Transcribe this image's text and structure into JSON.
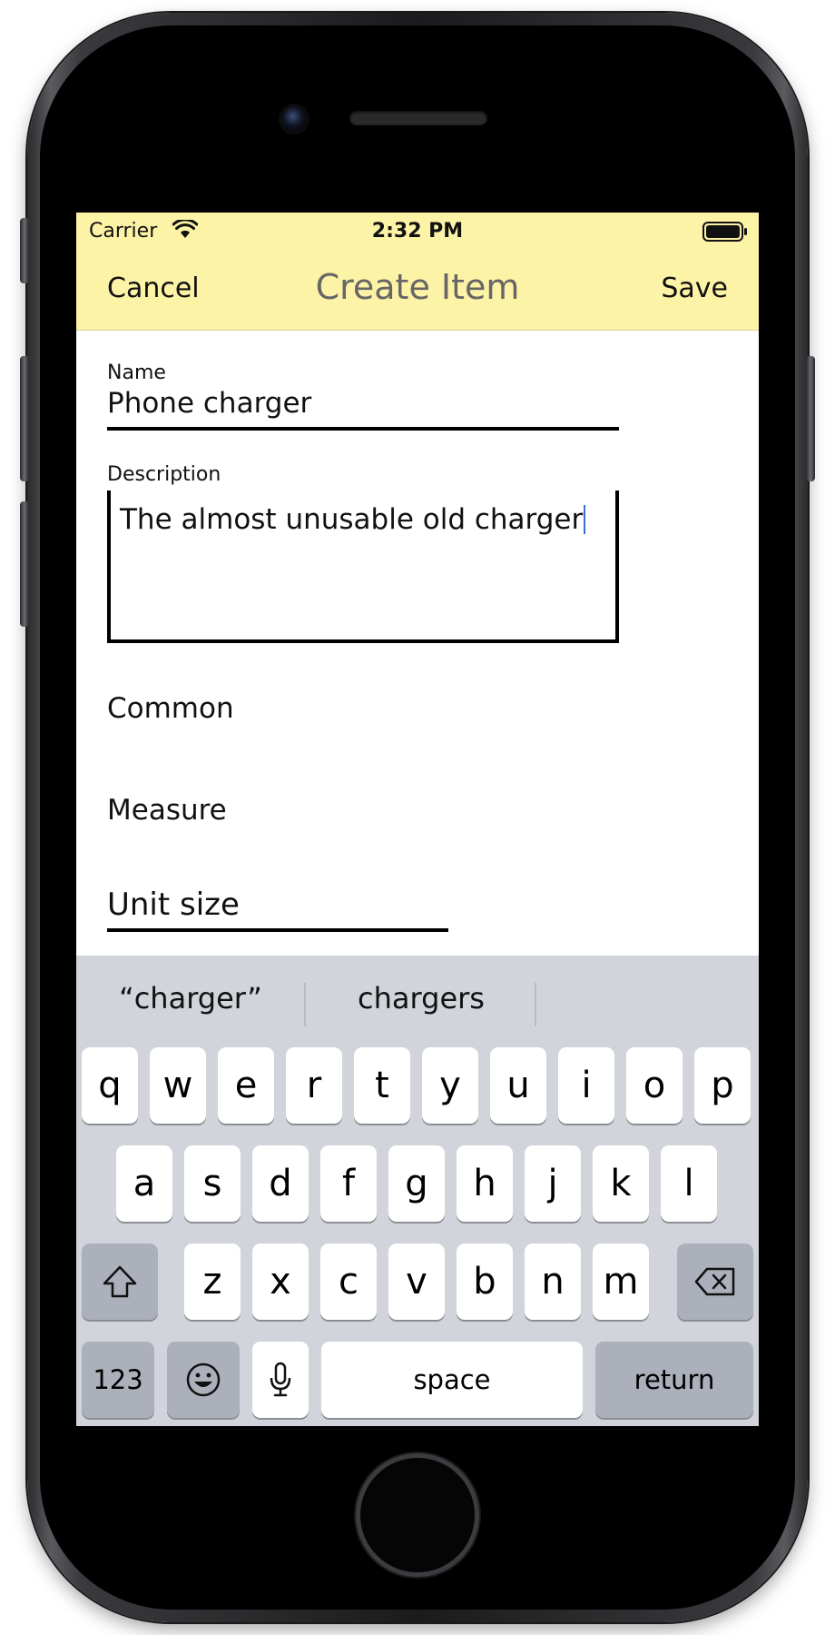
{
  "status_bar": {
    "carrier": "Carrier",
    "time": "2:32 PM"
  },
  "nav": {
    "cancel_label": "Cancel",
    "title": "Create Item",
    "save_label": "Save"
  },
  "form": {
    "name_label": "Name",
    "name_value": "Phone charger",
    "description_label": "Description",
    "description_value": "The almost unusable old charger",
    "common_label": "Common",
    "measure_label": "Measure",
    "unit_size_placeholder": "Unit size"
  },
  "keyboard": {
    "suggestions": [
      "“charger”",
      "chargers",
      ""
    ],
    "row1": [
      "q",
      "w",
      "e",
      "r",
      "t",
      "y",
      "u",
      "i",
      "o",
      "p"
    ],
    "row2": [
      "a",
      "s",
      "d",
      "f",
      "g",
      "h",
      "j",
      "k",
      "l"
    ],
    "row3": [
      "z",
      "x",
      "c",
      "v",
      "b",
      "n",
      "m"
    ],
    "numbers_label": "123",
    "space_label": "space",
    "return_label": "return"
  },
  "colors": {
    "header_bg": "#fdf3a6",
    "keyboard_bg": "#d1d4db",
    "caret": "#3a6fd8"
  },
  "icons": {
    "wifi": "wifi-icon",
    "battery": "battery-icon",
    "shift": "shift-icon",
    "backspace": "backspace-icon",
    "emoji": "emoji-icon",
    "microphone": "microphone-icon"
  }
}
